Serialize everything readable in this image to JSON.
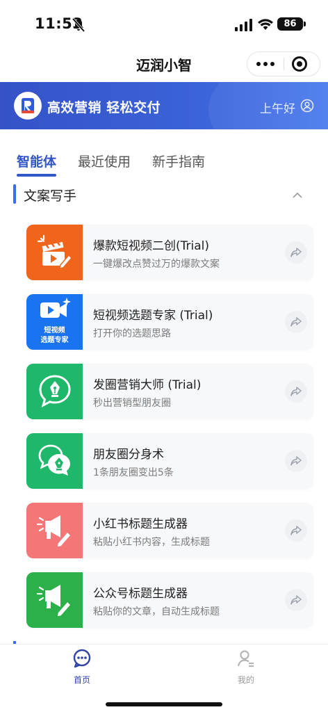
{
  "status": {
    "time": "11:53",
    "battery": "86"
  },
  "header": {
    "title": "迈润小智"
  },
  "banner": {
    "slogan": "高效营销 轻松交付",
    "greeting": "上午好"
  },
  "tabs": [
    {
      "label": "智能体",
      "active": true
    },
    {
      "label": "最近使用",
      "active": false
    },
    {
      "label": "新手指南",
      "active": false
    }
  ],
  "section": {
    "title": "文案写手"
  },
  "cards": [
    {
      "title": "爆款短视频二创(Trial)",
      "subtitle": "一键爆改点赞过万的爆款文案",
      "color": "#f0651c"
    },
    {
      "title": "短视频选题专家 (Trial)",
      "subtitle": "打开你的选题思路",
      "color": "#1a73f0",
      "icon_text": [
        "短视频",
        "选题专家"
      ]
    },
    {
      "title": "发圈营销大师 (Trial)",
      "subtitle": "秒出营销型朋友圈",
      "color": "#1fb86a"
    },
    {
      "title": "朋友圈分身术",
      "subtitle": "1条朋友圈变出5条",
      "color": "#1fb86a"
    },
    {
      "title": "小红书标题生成器",
      "subtitle": "粘贴小红书内容，生成标题",
      "color": "#f47676"
    },
    {
      "title": "公众号标题生成器",
      "subtitle": "粘贴你的文章，自动生成标题",
      "color": "#2cb14a"
    }
  ],
  "nav": [
    {
      "label": "首页",
      "active": true
    },
    {
      "label": "我的",
      "active": false
    }
  ],
  "colors": {
    "accent": "#3356c7",
    "banner": "#3b5fd6"
  }
}
